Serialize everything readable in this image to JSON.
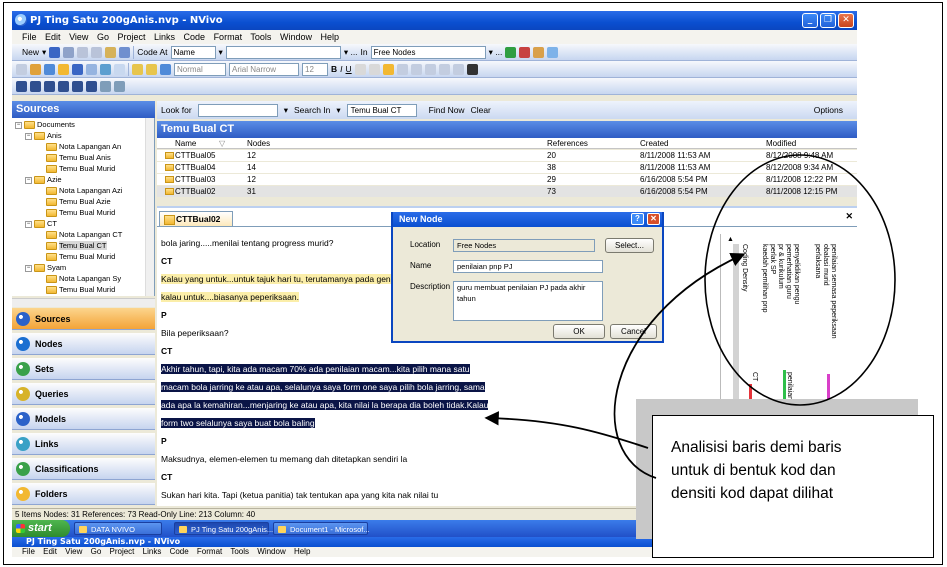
{
  "window": {
    "title": "PJ Ting Satu 200gAnis.nvp - NVivo",
    "menu": [
      "File",
      "Edit",
      "View",
      "Go",
      "Project",
      "Links",
      "Code",
      "Format",
      "Tools",
      "Window",
      "Help"
    ]
  },
  "toolbar": {
    "new_label": "New",
    "code_at_label": "Code At",
    "code_at_value": "Name",
    "in_label": "In",
    "in_value": "Free Nodes",
    "style_value": "Normal",
    "font_value": "Arial Narrow",
    "size_value": "12"
  },
  "sources": {
    "header": "Sources",
    "tree": [
      {
        "label": "Documents",
        "level": 0,
        "expander": "⊟"
      },
      {
        "label": "Anis",
        "level": 1,
        "expander": "⊟"
      },
      {
        "label": "Nota Lapangan An",
        "level": 2
      },
      {
        "label": "Temu Bual Anis",
        "level": 2
      },
      {
        "label": "Temu Bual Murid",
        "level": 2
      },
      {
        "label": "Azie",
        "level": 1,
        "expander": "⊟"
      },
      {
        "label": "Nota Lapangan Azi",
        "level": 2
      },
      {
        "label": "Temu Bual Azie",
        "level": 2
      },
      {
        "label": "Temu Bual Murid",
        "level": 2
      },
      {
        "label": "CT",
        "level": 1,
        "expander": "⊟"
      },
      {
        "label": "Nota Lapangan CT",
        "level": 2
      },
      {
        "label": "Temu Bual CT",
        "level": 2,
        "selected": true
      },
      {
        "label": "Temu Bual Murid",
        "level": 2
      },
      {
        "label": "Syam",
        "level": 1,
        "expander": "⊟"
      },
      {
        "label": "Nota Lapangan Sy",
        "level": 2
      },
      {
        "label": "Temu Bual Murid",
        "level": 2
      }
    ]
  },
  "nav": [
    {
      "label": "Sources",
      "active": true,
      "color": "#2b62c9"
    },
    {
      "label": "Nodes",
      "active": false,
      "color": "#1b6fd1"
    },
    {
      "label": "Sets",
      "active": false,
      "color": "#3aa14a"
    },
    {
      "label": "Queries",
      "active": false,
      "color": "#d7b32a"
    },
    {
      "label": "Models",
      "active": false,
      "color": "#2b62c9"
    },
    {
      "label": "Links",
      "active": false,
      "color": "#3aa1c6"
    },
    {
      "label": "Classifications",
      "active": false,
      "color": "#3aa14a"
    },
    {
      "label": "Folders",
      "active": false,
      "color": "#f2b832"
    }
  ],
  "lookfor": {
    "label": "Look for",
    "search_in_label": "Search In",
    "search_in_value": "Temu Bual CT",
    "find_now": "Find Now",
    "clear": "Clear",
    "options": "Options"
  },
  "list": {
    "title": "Temu Bual CT",
    "columns": [
      "Name",
      "Nodes",
      "References",
      "Created",
      "Modified"
    ],
    "rows": [
      {
        "name": "CTTBual05",
        "nodes": "12",
        "refs": "20",
        "created": "8/11/2008 11:53 AM",
        "modified": "8/12/2008 9:48 AM"
      },
      {
        "name": "CTTBual04",
        "nodes": "14",
        "refs": "38",
        "created": "8/11/2008 11:53 AM",
        "modified": "8/12/2008 9:34 AM"
      },
      {
        "name": "CTTBual03",
        "nodes": "12",
        "refs": "29",
        "created": "6/16/2008 5:54 PM",
        "modified": "8/11/2008 12:22 PM"
      },
      {
        "name": "CTTBual02",
        "nodes": "31",
        "refs": "73",
        "created": "6/16/2008 5:54 PM",
        "modified": "8/11/2008 12:15 PM",
        "selected": true
      }
    ]
  },
  "document": {
    "tab": "CTTBual02",
    "paragraphs": [
      {
        "text": "bola jaring.....menilai tentang progress murid?",
        "style": "plain"
      },
      {
        "text": "CT",
        "style": "bold"
      },
      {
        "text": "Kalau yang untuk...untuk tajuk hari tu,  terutamanya pada gen",
        "style": "yel"
      },
      {
        "text": "kalau untuk....biasanya peperiksaan.",
        "style": "yel"
      },
      {
        "text": "P",
        "style": "bold"
      },
      {
        "text": "Bila peperiksaan?",
        "style": "plain"
      },
      {
        "text": "CT",
        "style": "bold"
      },
      {
        "text": "Akhir tahun, tapi, kita ada macam 70% ada penilaian macam...kita pilih mana satu",
        "style": "hl"
      },
      {
        "text": "macam bola jarring ke atau apa, selalunya saya form one saya pilih bola jarring, sama",
        "style": "hl"
      },
      {
        "text": "ada apa la kemahiran...menjaring ke atau apa, kita nilai la berapa dia boleh tidak.Kalau",
        "style": "hl"
      },
      {
        "text": "form two selalunya saya buat bola baling",
        "style": "hl"
      },
      {
        "text": "P",
        "style": "bold"
      },
      {
        "text": "Maksudnya, elemen-elemen tu memang dah ditetapkan sendiri la",
        "style": "plain"
      },
      {
        "text": "CT",
        "style": "bold"
      },
      {
        "text": "Sukan hari kita. Tapi (ketua panitia) tak tentukan apa yang kita nak nilai tu",
        "style": "plain"
      }
    ],
    "coding_stripes": {
      "labels": [
        "penilaian semasa peperiksaan",
        "obalasi murid",
        "perlaksana",
        "penyelidikan pengu",
        "pemerhatian guru",
        "pr & kurikulum",
        "perlak SP",
        "kaedah pemilihan pnp",
        "Coding Density"
      ],
      "stripe_labels": [
        "CT",
        "penilaian semasa"
      ],
      "colors": [
        "#e6333a",
        "#2fbf4a",
        "#d93fc9"
      ]
    }
  },
  "dialog": {
    "title": "New Node",
    "location_label": "Location",
    "location_value": "Free Nodes",
    "select_button": "Select...",
    "name_label": "Name",
    "name_value": "penilaian pnp PJ",
    "description_label": "Description",
    "description_value": "guru membuat penilaian PJ pada akhir tahun",
    "ok": "OK",
    "cancel": "Cancel"
  },
  "status": "5 Items   Nodes: 31   References: 73   Read-Only   Line: 213   Column: 40",
  "taskbar": {
    "start": "start",
    "items": [
      "DATA NVIVO",
      "PJ Ting Satu 200gAnis...",
      "Document1 - Microsof..."
    ]
  },
  "second_window_title": "PJ Ting Satu 200gAnis.nvp - NVivo",
  "annotation": {
    "text": [
      "Analisisi baris demi baris",
      "untuk di bentuk kod dan",
      "densiti kod dapat dilihat"
    ]
  }
}
